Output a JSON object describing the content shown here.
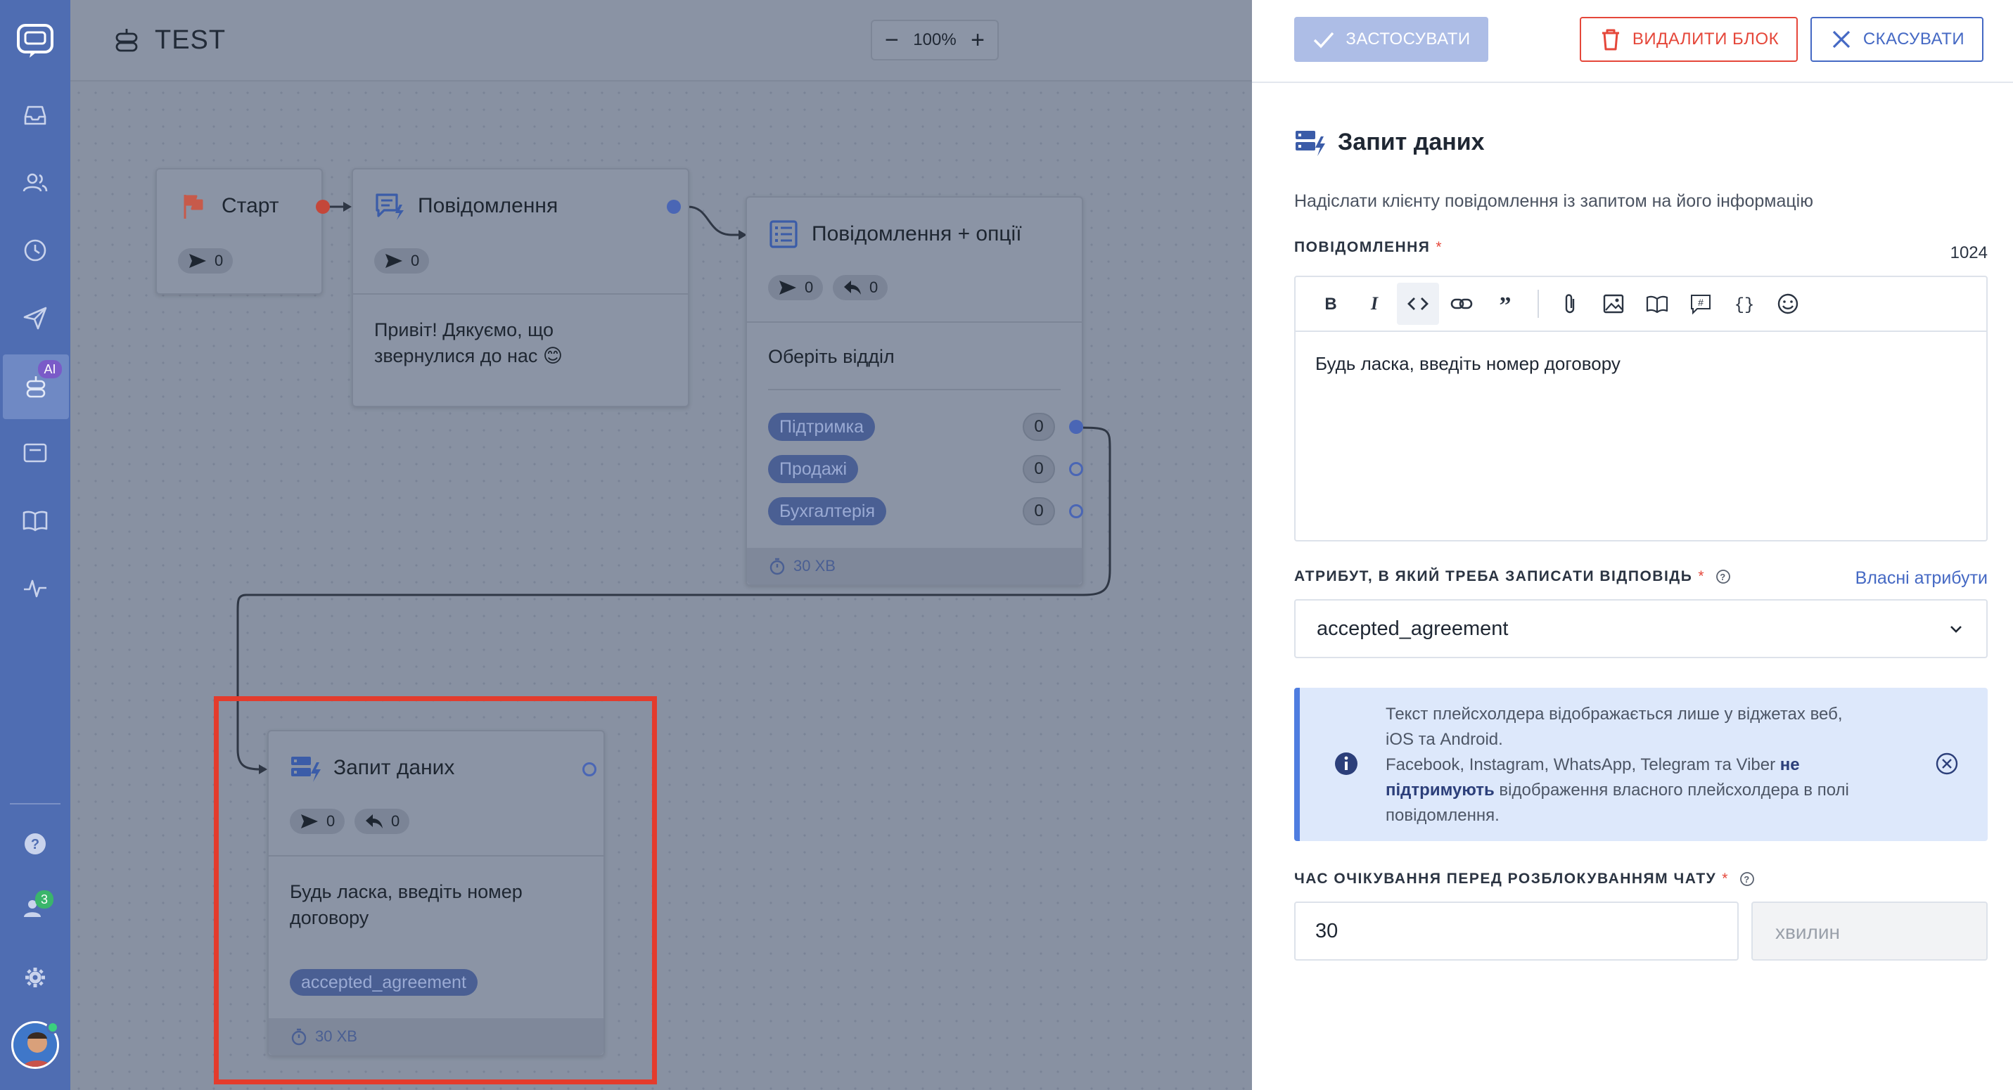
{
  "canvas": {
    "title": "TEST",
    "zoom": "100%",
    "zoom_out": "−",
    "zoom_in": "+"
  },
  "nav": {
    "ai_badge": "AI",
    "team_badge": "3"
  },
  "nodes": {
    "start": {
      "title": "Старт",
      "sent": "0"
    },
    "message": {
      "title": "Повідомлення",
      "sent": "0",
      "text_line1": "Привіт! Дякуємо, що",
      "text_line2": "звернулися до нас 😊"
    },
    "options": {
      "title": "Повідомлення + опції",
      "sent": "0",
      "replies": "0",
      "prompt": "Оберіть відділ",
      "items": [
        {
          "label": "Підтримка",
          "count": "0"
        },
        {
          "label": "Продажі",
          "count": "0"
        },
        {
          "label": "Бухгалтерія",
          "count": "0"
        }
      ],
      "timeout": "30 ХВ"
    },
    "data_request": {
      "title": "Запит даних",
      "sent": "0",
      "replies": "0",
      "text_line1": "Будь ласка, введіть номер",
      "text_line2": "договору",
      "attribute": "accepted_agreement",
      "timeout": "30 ХВ"
    }
  },
  "panel": {
    "apply": "ЗАСТОСУВАТИ",
    "delete": "ВИДАЛИТИ БЛОК",
    "cancel": "СКАСУВАТИ",
    "title": "Запит даних",
    "description": "Надіслати клієнту повідомлення із запитом на його інформацію",
    "message_label": "ПОВІДОМЛЕННЯ",
    "required_mark": "*",
    "char_count": "1024",
    "message_text": "Будь ласка, введіть номер договору",
    "attribute_label": "АТРИБУТ, В ЯКИЙ ТРЕБА ЗАПИСАТИ ВІДПОВІДЬ",
    "custom_attributes_link": "Власні атрибути",
    "attribute_value": "accepted_agreement",
    "notice_line1": "Текст плейсхолдера відображається лише у віджетах веб,",
    "notice_line2": "iOS та Android.",
    "notice_line3a": "Facebook, Instagram, WhatsApp, Telegram та Viber ",
    "notice_line3b": "не",
    "notice_line4a": "підтримують",
    "notice_line4b": " відображення власного плейсхолдера в полі",
    "notice_line5": "повідомлення.",
    "wait_label": "ЧАС ОЧІКУВАННЯ ПЕРЕД РОЗБЛОКУВАННЯМ ЧАТУ",
    "wait_value": "30",
    "wait_unit": "хвилин"
  },
  "colors": {
    "nav_bg": "#4f6db2",
    "accent": "#4569c4",
    "danger": "#e5473a",
    "highlight": "#e43b2c"
  }
}
